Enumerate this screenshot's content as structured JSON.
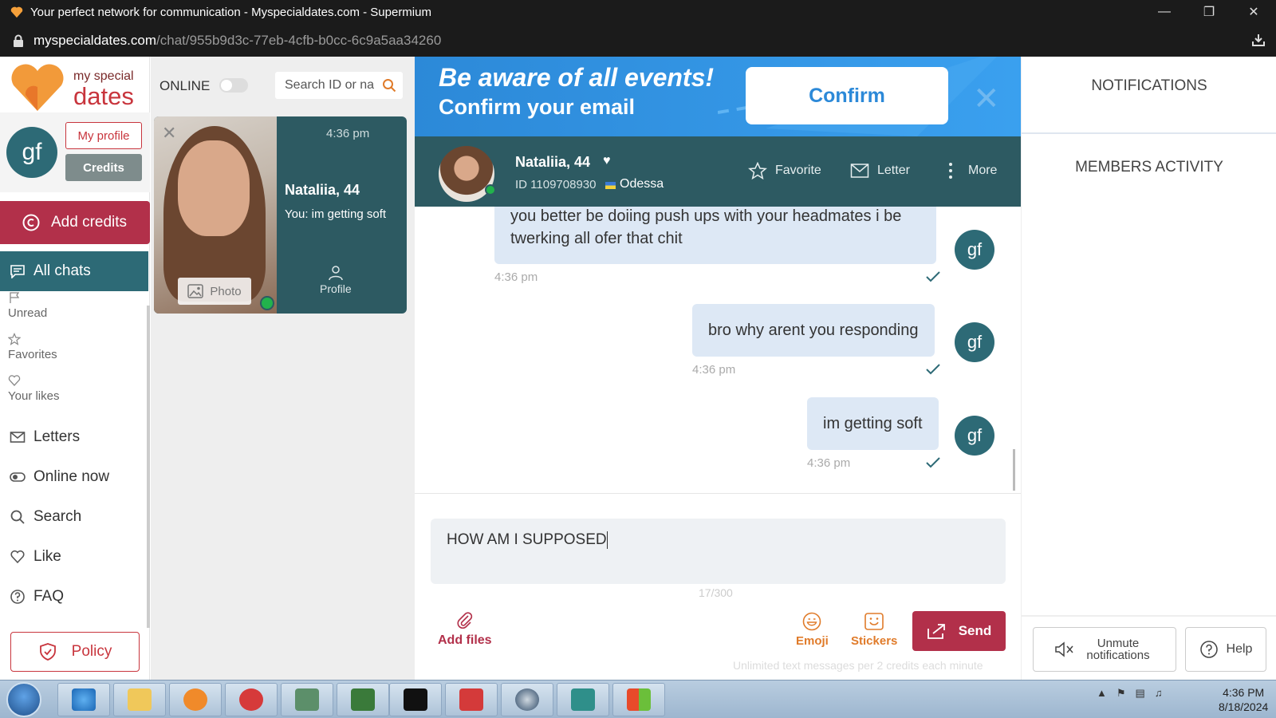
{
  "window": {
    "title": "Your perfect network for communication - Myspecialdates.com - Supermium",
    "url_host": "myspecialdates.com",
    "url_path": "/chat/955b9d3c-77eb-4cfb-b0cc-6c9a5aa34260"
  },
  "logo": {
    "line1": "my special",
    "line2": "dates"
  },
  "user": {
    "initials": "gf",
    "my_profile_label": "My profile",
    "credits_label": "Credits"
  },
  "add_credits_label": "Add credits",
  "nav": {
    "all_chats": "All chats",
    "unread": "Unread",
    "favorites": "Favorites",
    "your_likes": "Your likes",
    "letters": "Letters",
    "online_now": "Online now",
    "search": "Search",
    "like": "Like",
    "faq": "FAQ",
    "policy": "Policy"
  },
  "chat_list": {
    "online_label": "ONLINE",
    "search_placeholder": "Search ID or na",
    "card": {
      "time": "4:36 pm",
      "name": "Nataliia, 44",
      "last_message": "You:  im getting soft",
      "photo_label": "Photo",
      "profile_label": "Profile"
    }
  },
  "banner": {
    "headline": "Be aware of all events!",
    "subline": "Confirm your email",
    "confirm_label": "Confirm"
  },
  "chat_header": {
    "name": "Nataliia, 44",
    "id_label": "ID 1109708930",
    "city": "Odessa",
    "favorite_label": "Favorite",
    "letter_label": "Letter",
    "more_label": "More"
  },
  "messages": [
    {
      "text": "you better be doiing push ups with your headmates i be twerking all ofer that chit",
      "time": "4:36 pm",
      "avatar": "gf"
    },
    {
      "text": "bro why arent you responding",
      "time": "4:36 pm",
      "avatar": "gf"
    },
    {
      "text": "im getting soft",
      "time": "4:36 pm",
      "avatar": "gf"
    }
  ],
  "composer": {
    "value": "HOW AM I SUPPOSED",
    "counter": "17/300",
    "add_files_label": "Add files",
    "emoji_label": "Emoji",
    "stickers_label": "Stickers",
    "send_label": "Send",
    "footnote": "Unlimited text messages per 2 credits each minute"
  },
  "right_panel": {
    "notifications_title": "NOTIFICATIONS",
    "members_activity_title": "MEMBERS ACTIVITY",
    "unmute_label": "Unmute notifications",
    "help_label": "Help"
  },
  "taskbar": {
    "time": "4:36 PM",
    "date": "8/18/2024"
  },
  "colors": {
    "brand_red": "#b2304a",
    "teal": "#2d6a76",
    "banner_blue": "#2c89d8",
    "bubble": "#dde8f5"
  }
}
